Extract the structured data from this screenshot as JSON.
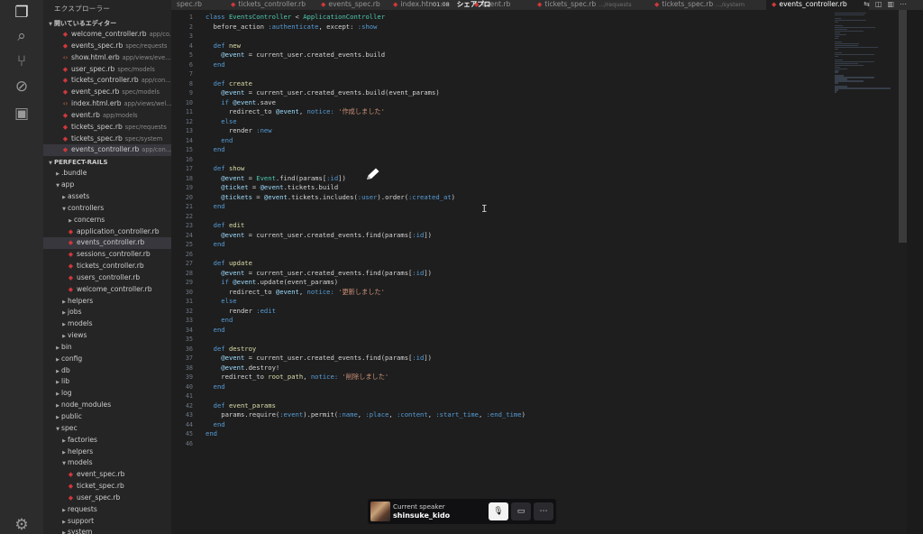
{
  "sidebar": {
    "title": "エクスプローラー",
    "open_editors_title": "開いているエディター",
    "project_title": "PERFECT-RAILS",
    "open_editors": [
      {
        "name": "welcome_controller.rb",
        "desc": "app/co...",
        "type": "rb"
      },
      {
        "name": "events_spec.rb",
        "desc": "spec/requests",
        "type": "rb"
      },
      {
        "name": "show.html.erb",
        "desc": "app/views/eve...",
        "type": "html"
      },
      {
        "name": "user_spec.rb",
        "desc": "spec/models",
        "type": "rb"
      },
      {
        "name": "tickets_controller.rb",
        "desc": "app/con...",
        "type": "rb"
      },
      {
        "name": "event_spec.rb",
        "desc": "spec/models",
        "type": "rb"
      },
      {
        "name": "index.html.erb",
        "desc": "app/views/wel...",
        "type": "html"
      },
      {
        "name": "event.rb",
        "desc": "app/models",
        "type": "rb"
      },
      {
        "name": "tickets_spec.rb",
        "desc": "spec/requests",
        "type": "rb"
      },
      {
        "name": "tickets_spec.rb",
        "desc": "spec/system",
        "type": "rb"
      },
      {
        "name": "events_controller.rb",
        "desc": "app/con...",
        "type": "rb",
        "selected": true
      }
    ],
    "tree": [
      {
        "name": ".bundle",
        "depth": 0,
        "kind": "folder",
        "open": false
      },
      {
        "name": "app",
        "depth": 0,
        "kind": "folder",
        "open": true
      },
      {
        "name": "assets",
        "depth": 1,
        "kind": "folder",
        "open": false
      },
      {
        "name": "controllers",
        "depth": 1,
        "kind": "folder",
        "open": true
      },
      {
        "name": "concerns",
        "depth": 2,
        "kind": "folder",
        "open": false
      },
      {
        "name": "application_controller.rb",
        "depth": 2,
        "kind": "rb"
      },
      {
        "name": "events_controller.rb",
        "depth": 2,
        "kind": "rb",
        "selected": true
      },
      {
        "name": "sessions_controller.rb",
        "depth": 2,
        "kind": "rb"
      },
      {
        "name": "tickets_controller.rb",
        "depth": 2,
        "kind": "rb"
      },
      {
        "name": "users_controller.rb",
        "depth": 2,
        "kind": "rb"
      },
      {
        "name": "welcome_controller.rb",
        "depth": 2,
        "kind": "rb"
      },
      {
        "name": "helpers",
        "depth": 1,
        "kind": "folder",
        "open": false
      },
      {
        "name": "jobs",
        "depth": 1,
        "kind": "folder",
        "open": false
      },
      {
        "name": "models",
        "depth": 1,
        "kind": "folder",
        "open": false
      },
      {
        "name": "views",
        "depth": 1,
        "kind": "folder",
        "open": false
      },
      {
        "name": "bin",
        "depth": 0,
        "kind": "folder",
        "open": false
      },
      {
        "name": "config",
        "depth": 0,
        "kind": "folder",
        "open": false
      },
      {
        "name": "db",
        "depth": 0,
        "kind": "folder",
        "open": false
      },
      {
        "name": "lib",
        "depth": 0,
        "kind": "folder",
        "open": false
      },
      {
        "name": "log",
        "depth": 0,
        "kind": "folder",
        "open": false
      },
      {
        "name": "node_modules",
        "depth": 0,
        "kind": "folder",
        "open": false
      },
      {
        "name": "public",
        "depth": 0,
        "kind": "folder",
        "open": false
      },
      {
        "name": "spec",
        "depth": 0,
        "kind": "folder",
        "open": true
      },
      {
        "name": "factories",
        "depth": 1,
        "kind": "folder",
        "open": false
      },
      {
        "name": "helpers",
        "depth": 1,
        "kind": "folder",
        "open": false
      },
      {
        "name": "models",
        "depth": 1,
        "kind": "folder",
        "open": true
      },
      {
        "name": "event_spec.rb",
        "depth": 2,
        "kind": "rb"
      },
      {
        "name": "ticket_spec.rb",
        "depth": 2,
        "kind": "rb"
      },
      {
        "name": "user_spec.rb",
        "depth": 2,
        "kind": "rb"
      },
      {
        "name": "requests",
        "depth": 1,
        "kind": "folder",
        "open": false
      },
      {
        "name": "support",
        "depth": 1,
        "kind": "folder",
        "open": false
      },
      {
        "name": "system",
        "depth": 1,
        "kind": "folder",
        "open": false
      }
    ]
  },
  "tabs": [
    {
      "name": "spec.rb",
      "desc": "",
      "dot": false
    },
    {
      "name": "tickets_controller.rb",
      "desc": "",
      "dot": true
    },
    {
      "name": "events_spec.rb",
      "desc": "",
      "dot": true
    },
    {
      "name": "index.html",
      "desc": "",
      "dot": true
    },
    {
      "name": "event.rb",
      "desc": "",
      "dot": true
    },
    {
      "name": "tickets_spec.rb",
      "desc": ".../requests",
      "dot": true
    },
    {
      "name": "tickets_spec.rb",
      "desc": ".../system",
      "dot": true
    },
    {
      "name": "events_controller.rb",
      "desc": "",
      "dot": true,
      "active": true
    }
  ],
  "recording": {
    "time": "01:08",
    "label": "シェアプロ"
  },
  "editor": {
    "lines": [
      [
        [
          "class ",
          "kw"
        ],
        [
          "EventsController",
          "cls"
        ],
        [
          " < ",
          "op"
        ],
        [
          "ApplicationController",
          "cls"
        ]
      ],
      [
        [
          "  before_action ",
          "txt"
        ],
        [
          ":authenticate",
          "sym"
        ],
        [
          ", except: ",
          "txt"
        ],
        [
          ":show",
          "sym"
        ]
      ],
      [],
      [
        [
          "  def ",
          "kw"
        ],
        [
          "new",
          "fn"
        ]
      ],
      [
        [
          "    @event",
          "ivar"
        ],
        [
          " = current_user.created_events.build",
          "txt"
        ]
      ],
      [
        [
          "  end",
          "kw"
        ]
      ],
      [],
      [
        [
          "  def ",
          "kw"
        ],
        [
          "create",
          "fn"
        ]
      ],
      [
        [
          "    @event",
          "ivar"
        ],
        [
          " = current_user.created_events.build(event_params)",
          "txt"
        ]
      ],
      [
        [
          "    if ",
          "kw"
        ],
        [
          "@event",
          "ivar"
        ],
        [
          ".save",
          "txt"
        ]
      ],
      [
        [
          "      redirect_to ",
          "txt"
        ],
        [
          "@event",
          "ivar"
        ],
        [
          ", ",
          "txt"
        ],
        [
          "notice:",
          "sym"
        ],
        [
          " '作成しました'",
          "str"
        ]
      ],
      [
        [
          "    else",
          "kw"
        ]
      ],
      [
        [
          "      render ",
          "txt"
        ],
        [
          ":new",
          "sym"
        ]
      ],
      [
        [
          "    end",
          "kw"
        ]
      ],
      [
        [
          "  end",
          "kw"
        ]
      ],
      [],
      [
        [
          "  def ",
          "kw"
        ],
        [
          "show",
          "fn"
        ]
      ],
      [
        [
          "    @event",
          "ivar"
        ],
        [
          " = ",
          "txt"
        ],
        [
          "Event",
          "cls"
        ],
        [
          ".find(params[",
          "txt"
        ],
        [
          ":id",
          "sym"
        ],
        [
          "])",
          "txt"
        ]
      ],
      [
        [
          "    @ticket",
          "ivar"
        ],
        [
          " = ",
          "txt"
        ],
        [
          "@event",
          "ivar"
        ],
        [
          ".tickets.build",
          "txt"
        ]
      ],
      [
        [
          "    @tickets",
          "ivar"
        ],
        [
          " = ",
          "txt"
        ],
        [
          "@event",
          "ivar"
        ],
        [
          ".tickets.includes(",
          "txt"
        ],
        [
          ":user",
          "sym"
        ],
        [
          ").order(",
          "txt"
        ],
        [
          ":created_at",
          "sym"
        ],
        [
          ")",
          "txt"
        ]
      ],
      [
        [
          "  end",
          "kw"
        ]
      ],
      [],
      [
        [
          "  def ",
          "kw"
        ],
        [
          "edit",
          "fn"
        ]
      ],
      [
        [
          "    @event",
          "ivar"
        ],
        [
          " = current_user.created_events.find(params[",
          "txt"
        ],
        [
          ":id",
          "sym"
        ],
        [
          "])",
          "txt"
        ]
      ],
      [
        [
          "  end",
          "kw"
        ]
      ],
      [],
      [
        [
          "  def ",
          "kw"
        ],
        [
          "update",
          "fn"
        ]
      ],
      [
        [
          "    @event",
          "ivar"
        ],
        [
          " = current_user.created_events.find(params[",
          "txt"
        ],
        [
          ":id",
          "sym"
        ],
        [
          "])",
          "txt"
        ]
      ],
      [
        [
          "    if ",
          "kw"
        ],
        [
          "@event",
          "ivar"
        ],
        [
          ".update(event_params)",
          "txt"
        ]
      ],
      [
        [
          "      redirect_to ",
          "txt"
        ],
        [
          "@event",
          "ivar"
        ],
        [
          ", ",
          "txt"
        ],
        [
          "notice:",
          "sym"
        ],
        [
          " '更新しました'",
          "str"
        ]
      ],
      [
        [
          "    else",
          "kw"
        ]
      ],
      [
        [
          "      render ",
          "txt"
        ],
        [
          ":edit",
          "sym"
        ]
      ],
      [
        [
          "    end",
          "kw"
        ]
      ],
      [
        [
          "  end",
          "kw"
        ]
      ],
      [],
      [
        [
          "  def ",
          "kw"
        ],
        [
          "destroy",
          "fn"
        ]
      ],
      [
        [
          "    @event",
          "ivar"
        ],
        [
          " = current_user.created_events.find(params[",
          "txt"
        ],
        [
          ":id",
          "sym"
        ],
        [
          "])",
          "txt"
        ]
      ],
      [
        [
          "    @event",
          "ivar"
        ],
        [
          ".destroy!",
          "txt"
        ]
      ],
      [
        [
          "    redirect_to ",
          "txt"
        ],
        [
          "root_path",
          "fn"
        ],
        [
          ", ",
          "txt"
        ],
        [
          "notice:",
          "sym"
        ],
        [
          " '削除しました'",
          "str"
        ]
      ],
      [
        [
          "  end",
          "kw"
        ]
      ],
      [],
      [
        [
          "  def ",
          "kw"
        ],
        [
          "event_params",
          "fn"
        ]
      ],
      [
        [
          "    params.require(",
          "txt"
        ],
        [
          ":event",
          "sym"
        ],
        [
          ").permit(",
          "txt"
        ],
        [
          ":name",
          "sym"
        ],
        [
          ", ",
          "txt"
        ],
        [
          ":place",
          "sym"
        ],
        [
          ", ",
          "txt"
        ],
        [
          ":content",
          "sym"
        ],
        [
          ", ",
          "txt"
        ],
        [
          ":start_time",
          "sym"
        ],
        [
          ", ",
          "txt"
        ],
        [
          ":end_time",
          "sym"
        ],
        [
          ")",
          "txt"
        ]
      ],
      [
        [
          "  end",
          "kw"
        ]
      ],
      [
        [
          "end",
          "kw"
        ]
      ],
      []
    ]
  },
  "call": {
    "label": "Current speaker",
    "name": "shinsuke_kido"
  },
  "colors": {
    "kw": "#569cd6",
    "cls": "#4ec9b0",
    "fn": "#dcdcaa",
    "ivar": "#9cdcfe",
    "sym": "#569cd6",
    "str": "#ce9178",
    "txt": "#d4d4d4",
    "op": "#d4d4d4"
  }
}
